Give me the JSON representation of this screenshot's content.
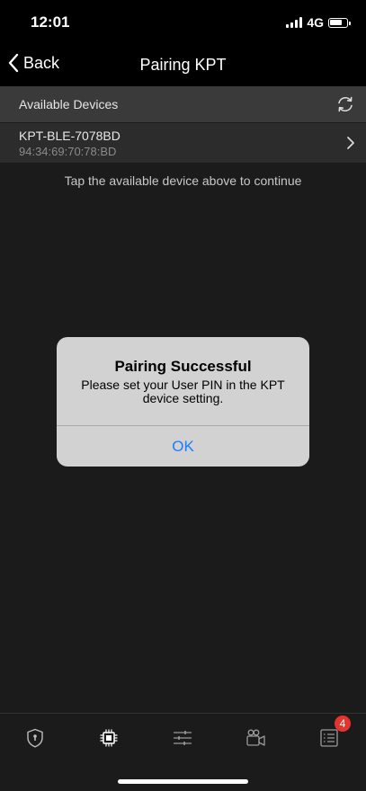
{
  "status": {
    "time": "12:01",
    "network": "4G"
  },
  "nav": {
    "back_label": "Back",
    "title": "Pairing KPT"
  },
  "section": {
    "label": "Available Devices"
  },
  "device": {
    "name": "KPT-BLE-7078BD",
    "mac": "94:34:69:70:78:BD"
  },
  "hint": "Tap the available device above to continue",
  "alert": {
    "title": "Pairing Successful",
    "message": "Please set your User PIN in the KPT device setting.",
    "ok_label": "OK"
  },
  "tabbar": {
    "icons": [
      "shield-icon",
      "chip-icon",
      "sliders-icon",
      "video-camera-icon",
      "list-icon"
    ],
    "badge": "4"
  },
  "colors": {
    "accent": "#1a7cff",
    "badge": "#e5342e"
  }
}
